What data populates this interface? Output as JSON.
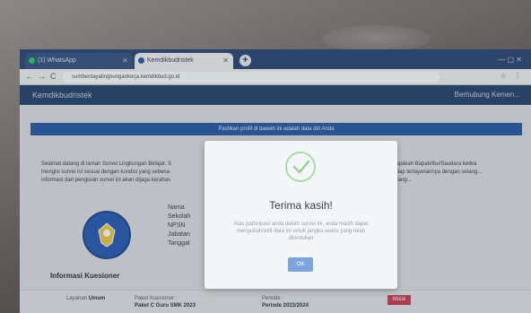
{
  "browser": {
    "tabs": [
      {
        "label": "(1) WhatsApp",
        "color": "#25d366"
      },
      {
        "label": "Kemdikbudristek",
        "color": "#2d5ea8"
      }
    ],
    "url": "sumberdayalingkungankerja.kemdikbud.go.id",
    "nav": {
      "back": "←",
      "forward": "→",
      "reload": "C"
    }
  },
  "page": {
    "brand": "Kemdikbudristek",
    "user": "Berhubung Kemen...",
    "banner": "Pastikan profil di bawah ini adalah data diri Anda",
    "intro_left": [
      "Selamat datang di laman Survei Lingkungan Belajar. S",
      "mengisi survei ini sesuai dengan kondisi yang sebena",
      "informasi dari pengisian survei ini akan dijaga kerahas"
    ],
    "intro_right": [
      "tuan apakah Bapak/Ibu/Saudara ketika",
      "terhadap terlayanannya dengan selang...",
      "inya yang..."
    ],
    "profile_labels": [
      "Nama",
      "Sekolah",
      "NPSN",
      "Jabatan",
      "Tanggal"
    ],
    "profile_extra": "A",
    "info_section": "Informasi Kuesioner",
    "bottom": {
      "label_left": "Layanan",
      "value_left": "Umum",
      "paket_label": "Paket Kuesioner :",
      "paket_value": "Paket C Guru SMK 2023",
      "periode_label": "Periode :",
      "periode_value": "Periode 2023/2024",
      "button": "Mulai"
    }
  },
  "modal": {
    "title": "Terima kasih!",
    "text": "Atas partisipasi anda dalam survei ini, anda masih dapat mengubah/edit data ini untuk jangka waktu yang telah ditentukan",
    "ok_label": "OK"
  },
  "colors": {
    "header": "#28476f",
    "banner": "#2d5ea8",
    "ok": "#7aa6dd",
    "check": "#a9dcaa"
  }
}
